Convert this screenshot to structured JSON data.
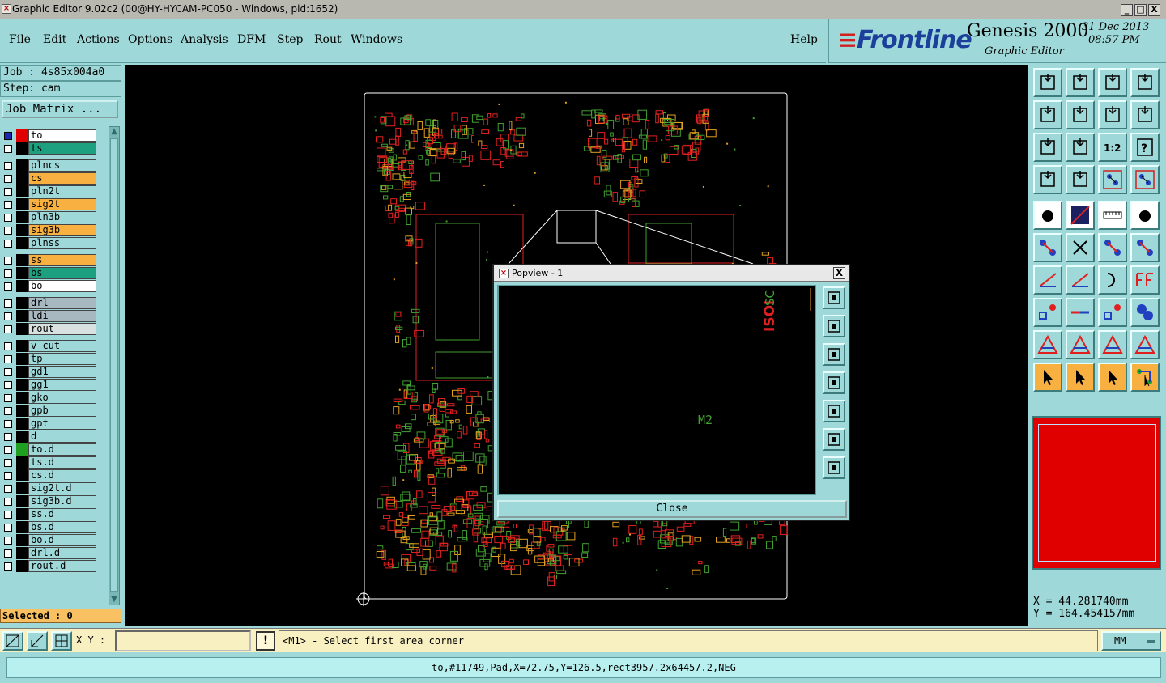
{
  "window": {
    "title": "Graphic Editor 9.02c2 (00@HY-HYCAM-PC050 - Windows, pid:1652)",
    "minimize": "_",
    "maximize": "□",
    "close": "X"
  },
  "menu": {
    "file": "File",
    "edit": "Edit",
    "actions": "Actions",
    "options": "Options",
    "analysis": "Analysis",
    "dfm": "DFM",
    "step": "Step",
    "rout": "Rout",
    "windows": "Windows",
    "help": "Help"
  },
  "brand": {
    "logo": "Frontline",
    "product": "Genesis 2000",
    "subtitle": "Graphic Editor",
    "date": "31 Dec 2013",
    "time": "08:57 PM"
  },
  "job": {
    "job_label": "Job : 4s85x004a0",
    "step_label": "Step: cam",
    "matrix_button": "Job Matrix ..."
  },
  "layers": [
    {
      "name": "to",
      "color": "#ffffff",
      "swatch": "#e00000",
      "checked": true
    },
    {
      "name": "ts",
      "color": "#1ca080",
      "swatch": "#000000",
      "checked": false
    },
    {
      "name": "plncs",
      "color": "#9fd8d8",
      "swatch": "#000000",
      "checked": false
    },
    {
      "name": "cs",
      "color": "#f8b040",
      "swatch": "#000000",
      "checked": false
    },
    {
      "name": "pln2t",
      "color": "#9fd8d8",
      "swatch": "#000000",
      "checked": false
    },
    {
      "name": "sig2t",
      "color": "#f8b040",
      "swatch": "#000000",
      "checked": false
    },
    {
      "name": "pln3b",
      "color": "#9fd8d8",
      "swatch": "#000000",
      "checked": false
    },
    {
      "name": "sig3b",
      "color": "#f8b040",
      "swatch": "#000000",
      "checked": false
    },
    {
      "name": "plnss",
      "color": "#9fd8d8",
      "swatch": "#000000",
      "checked": false
    },
    {
      "name": "ss",
      "color": "#f8b040",
      "swatch": "#000000",
      "checked": false
    },
    {
      "name": "bs",
      "color": "#1ca080",
      "swatch": "#000000",
      "checked": false
    },
    {
      "name": "bo",
      "color": "#ffffff",
      "swatch": "#000000",
      "checked": false
    },
    {
      "name": "drl",
      "color": "#a8b8c0",
      "swatch": "#000000",
      "checked": false
    },
    {
      "name": "ldi",
      "color": "#a8b8c0",
      "swatch": "#000000",
      "checked": false
    },
    {
      "name": "rout",
      "color": "#d8e0e0",
      "swatch": "#000000",
      "checked": false
    },
    {
      "name": "v-cut",
      "color": "#9fd8d8",
      "swatch": "#000000",
      "checked": false
    },
    {
      "name": "tp",
      "color": "#9fd8d8",
      "swatch": "#000000",
      "checked": false
    },
    {
      "name": "gd1",
      "color": "#9fd8d8",
      "swatch": "#000000",
      "checked": false
    },
    {
      "name": "gg1",
      "color": "#9fd8d8",
      "swatch": "#000000",
      "checked": false
    },
    {
      "name": "gko",
      "color": "#9fd8d8",
      "swatch": "#000000",
      "checked": false
    },
    {
      "name": "gpb",
      "color": "#9fd8d8",
      "swatch": "#000000",
      "checked": false
    },
    {
      "name": "gpt",
      "color": "#9fd8d8",
      "swatch": "#000000",
      "checked": false
    },
    {
      "name": "d",
      "color": "#9fd8d8",
      "swatch": "#000000",
      "checked": false
    },
    {
      "name": "to.d",
      "color": "#9fd8d8",
      "swatch": "#20a020",
      "checked": false
    },
    {
      "name": "ts.d",
      "color": "#9fd8d8",
      "swatch": "#000000",
      "checked": false
    },
    {
      "name": "cs.d",
      "color": "#9fd8d8",
      "swatch": "#000000",
      "checked": false
    },
    {
      "name": "sig2t.d",
      "color": "#9fd8d8",
      "swatch": "#000000",
      "checked": false
    },
    {
      "name": "sig3b.d",
      "color": "#9fd8d8",
      "swatch": "#000000",
      "checked": false
    },
    {
      "name": "ss.d",
      "color": "#9fd8d8",
      "swatch": "#000000",
      "checked": false
    },
    {
      "name": "bs.d",
      "color": "#9fd8d8",
      "swatch": "#000000",
      "checked": false
    },
    {
      "name": "bo.d",
      "color": "#9fd8d8",
      "swatch": "#000000",
      "checked": false
    },
    {
      "name": "drl.d",
      "color": "#9fd8d8",
      "swatch": "#000000",
      "checked": false
    },
    {
      "name": "rout.d",
      "color": "#9fd8d8",
      "swatch": "#000000",
      "checked": false
    }
  ],
  "selected": "Selected : 0",
  "popview": {
    "title": "Popview - 1",
    "close_x": "X",
    "close_button": "Close",
    "label_m2": "M2",
    "label_red": "ISOl",
    "label_green": "SC"
  },
  "coords": {
    "x": "X = 44.281740mm",
    "y": "Y = 164.454157mm"
  },
  "command": {
    "xy_label": "X Y :",
    "xy_value": "",
    "message_icon": "!",
    "message": "<M1> - Select first area corner",
    "units": "MM"
  },
  "status": "to,#11749,Pad,X=72.75,Y=126.5,rect3957.2x64457.2,NEG",
  "colors": {
    "panel": "#9fd8d8",
    "canvas": "#000000",
    "trace_red": "#e02020",
    "trace_green": "#40a030",
    "trace_orange": "#e0a020",
    "minimap": "#e00000"
  }
}
